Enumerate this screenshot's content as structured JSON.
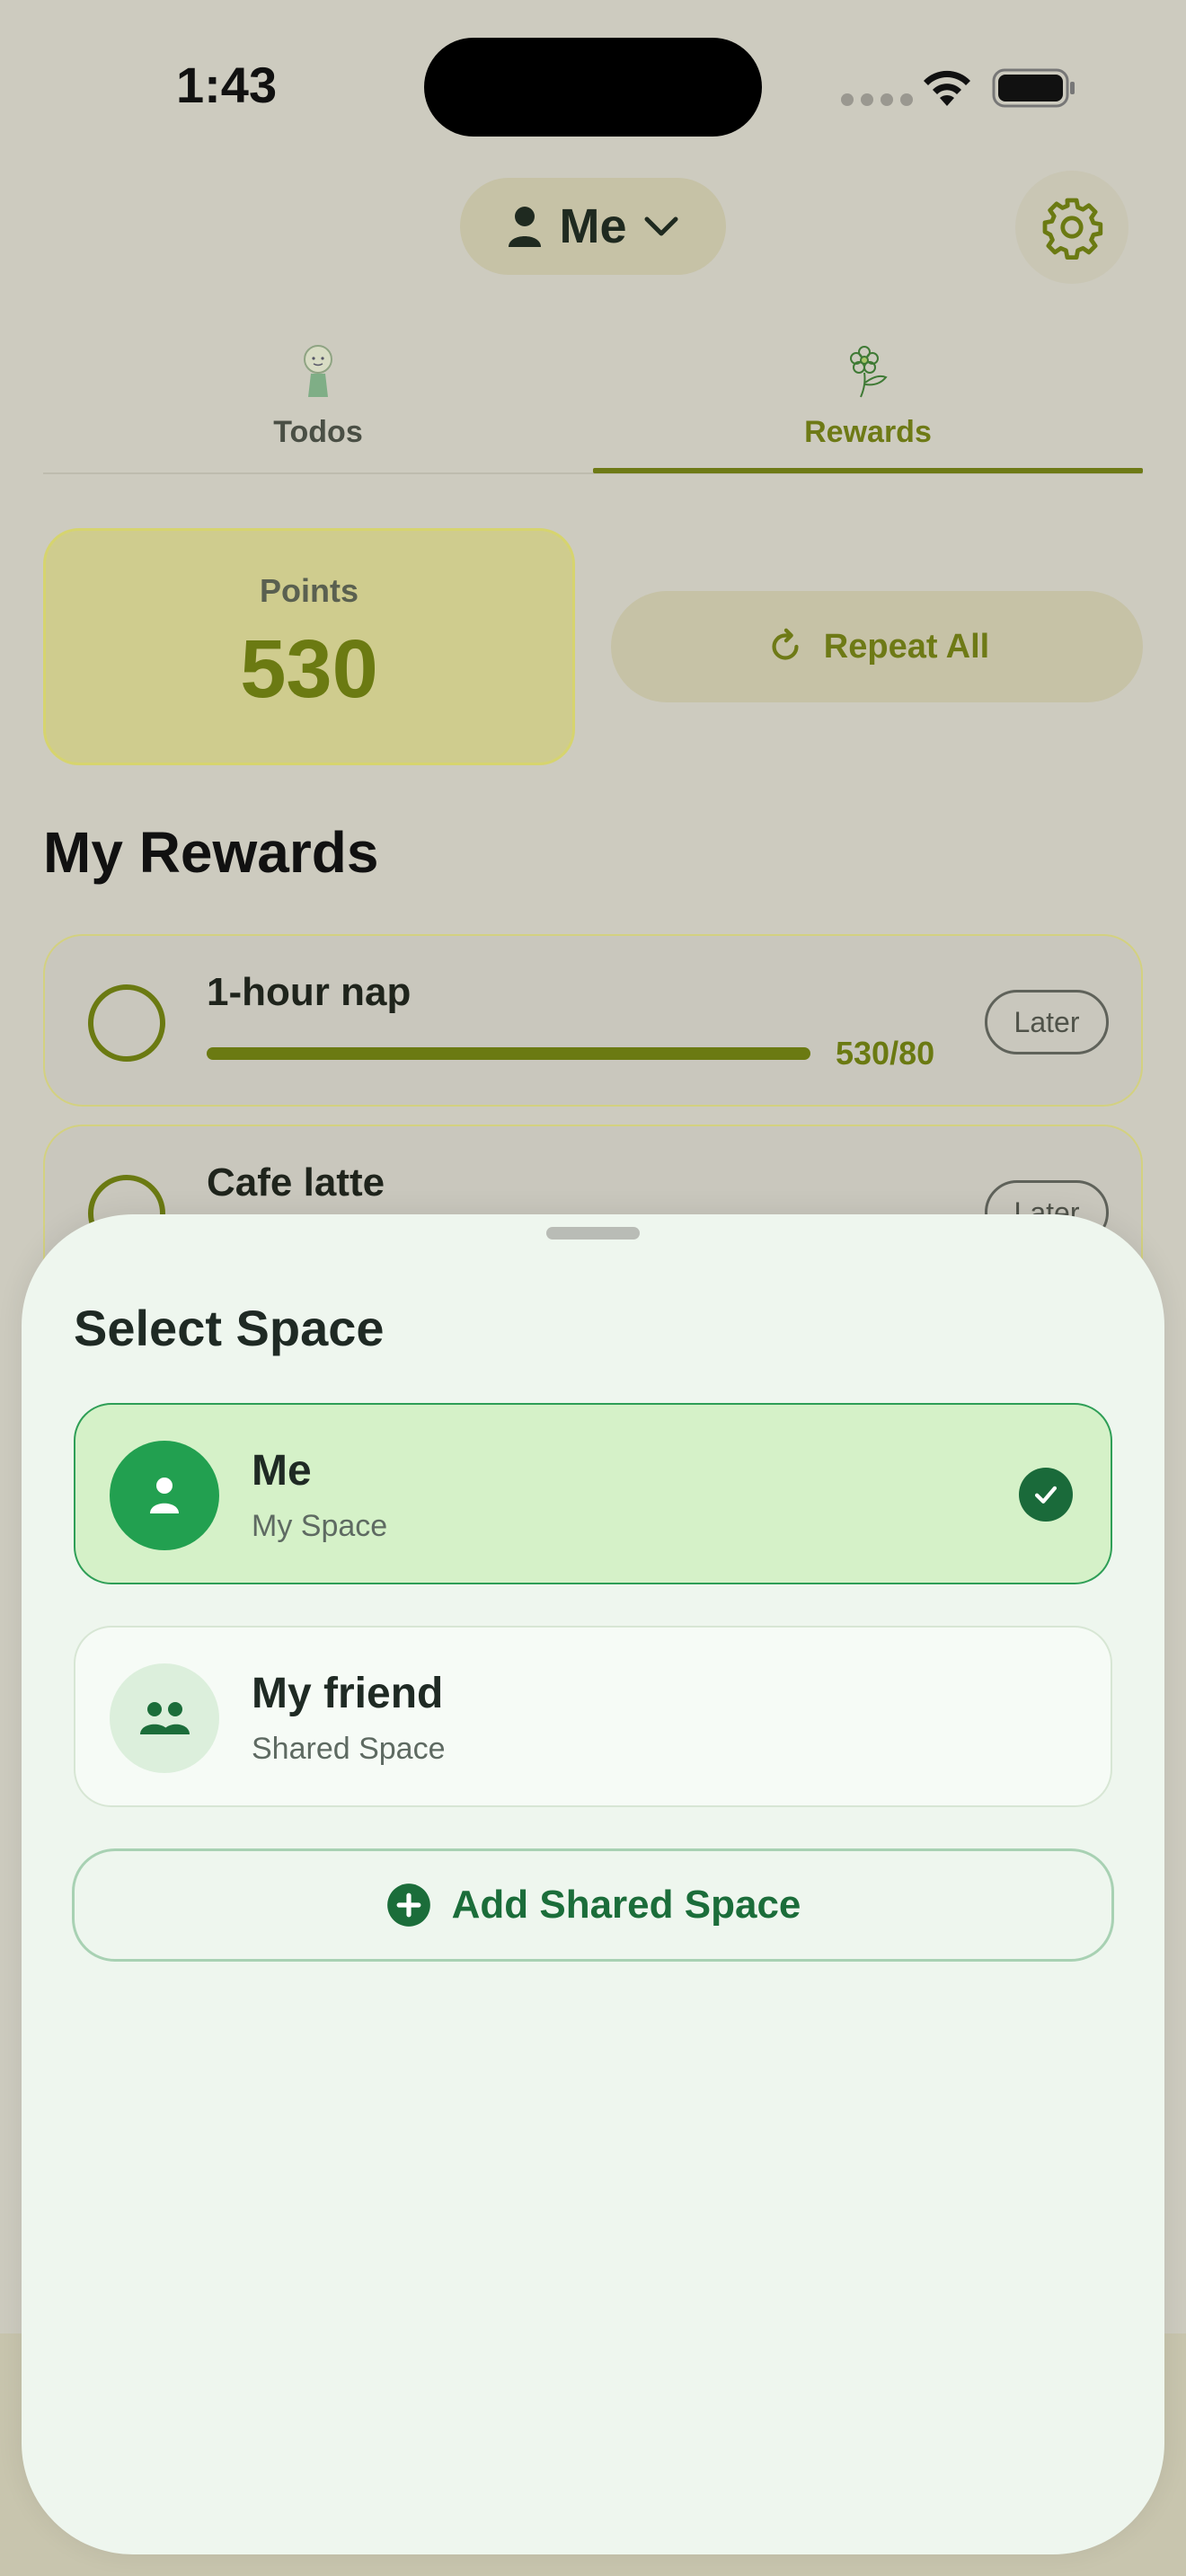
{
  "status_bar": {
    "time": "1:43"
  },
  "header": {
    "space_label": "Me"
  },
  "tabs": [
    {
      "label": "Todos"
    },
    {
      "label": "Rewards"
    }
  ],
  "points": {
    "label": "Points",
    "value": "530"
  },
  "repeat_all": {
    "label": "Repeat All"
  },
  "rewards": {
    "title": "My Rewards",
    "items": [
      {
        "name": "1-hour nap",
        "progress": "530/80",
        "progress_fraction": 1,
        "action": "Later"
      },
      {
        "name": "Cafe latte",
        "action": "Later"
      }
    ]
  },
  "sheet": {
    "title": "Select Space",
    "options": [
      {
        "title": "Me",
        "subtitle": "My Space",
        "selected": true
      },
      {
        "title": "My friend",
        "subtitle": "Shared Space",
        "selected": false
      }
    ],
    "add_label": "Add Shared Space"
  },
  "colors": {
    "accent": "#6b7a12",
    "sheet_green": "#22a050",
    "sheet_background": "#eef6ee"
  },
  "icons": {
    "space_pill": "person-icon",
    "space_chevron": "chevron-down-icon",
    "settings": "gear-icon",
    "todos_tab": "character-icon",
    "rewards_tab": "flower-icon",
    "repeat": "refresh-icon",
    "option_me": "person-icon",
    "option_friend": "people-icon",
    "selected": "checkmark-icon",
    "add": "plus-circle-icon"
  }
}
